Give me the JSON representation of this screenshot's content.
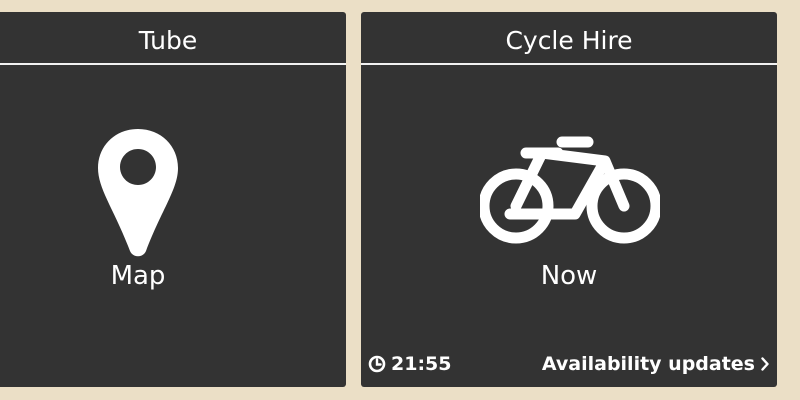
{
  "tiles": {
    "tube": {
      "title": "Tube",
      "label": "Map",
      "icon": "map-pin-icon"
    },
    "cycle_hire": {
      "title": "Cycle Hire",
      "label": "Now",
      "icon": "bicycle-icon",
      "footer": {
        "time": "21:55",
        "time_icon": "clock-icon",
        "link_label": "Availability updates",
        "link_icon": "chevron-right-icon"
      }
    }
  },
  "colors": {
    "background": "#ebdfc6",
    "tile": "#333333",
    "text": "#ffffff"
  }
}
